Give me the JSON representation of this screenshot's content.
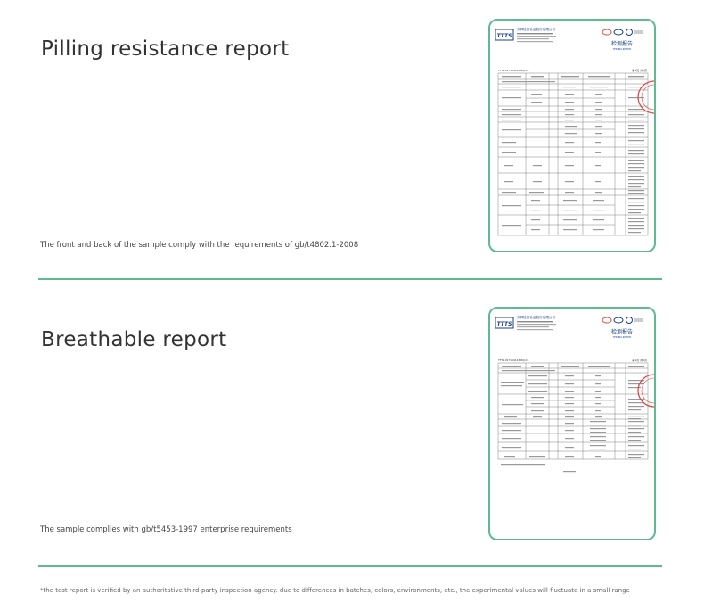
{
  "sections": [
    {
      "title": "Pilling resistance report",
      "description": "The front and back of the sample comply with the requirements of gb/t4802.1-2008",
      "report": {
        "logo": "TTTS",
        "company": "天祥检测认证股份有限公司",
        "heading": "检测报告",
        "heading_en": "TESTING REPORT",
        "report_no": "TTTS-W71941160DJ-01",
        "page": "第1页 共1页"
      }
    },
    {
      "title": "Breathable report",
      "description": "The sample complies with gb/t5453-1997 enterprise requirements",
      "report": {
        "logo": "TTTS",
        "company": "天祥检测认证股份有限公司",
        "heading": "检测报告",
        "heading_en": "TESTING REPORT",
        "report_no": "TTTS-W71941160DJ-01",
        "page": "第1页 共1页"
      }
    }
  ],
  "footnote": "*the test report is verified by an authoritative third-party inspection agency. due to differences in batches, colors, environments, etc., the experimental values will fluctuate in a small range",
  "colors": {
    "accent": "#5fba91",
    "seal": "#d94a4a",
    "logo_blue": "#1d3f8c"
  },
  "icons": [
    "cma-icon",
    "cnas-icon",
    "ilac-mra-icon",
    "ttts-logo-icon",
    "inspection-seal-icon"
  ]
}
